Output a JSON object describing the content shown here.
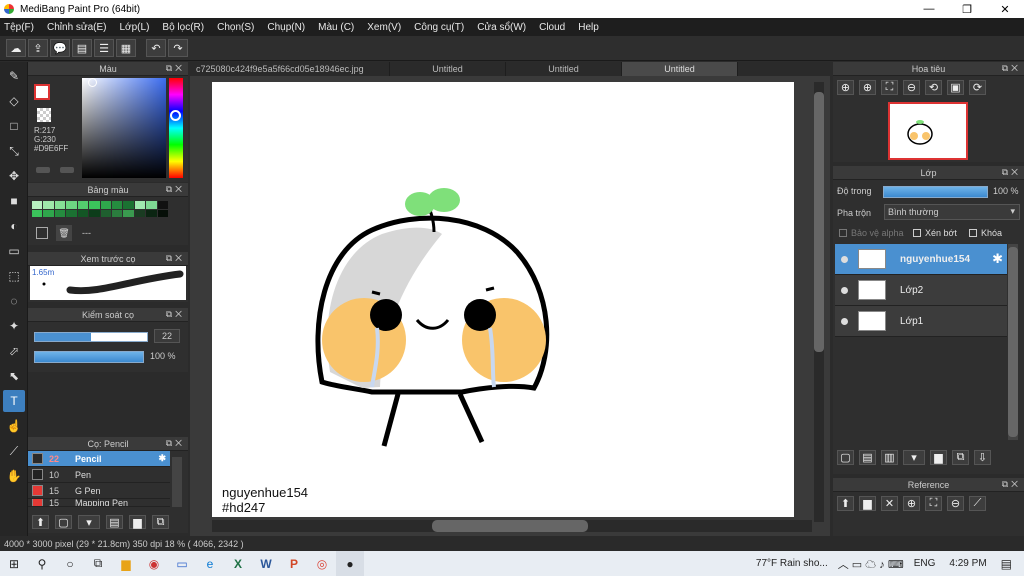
{
  "window": {
    "title": "MediBang Paint Pro (64bit)"
  },
  "menu": [
    "Tệp(F)",
    "Chỉnh sửa(E)",
    "Lớp(L)",
    "Bộ lọc(R)",
    "Chọn(S)",
    "Chụp(N)",
    "Màu (C)",
    "Xem(V)",
    "Công cụ(T)",
    "Cửa sổ(W)",
    "Cloud",
    "Help"
  ],
  "color_panel": {
    "title": "Màu",
    "r": "R:217",
    "g": "G:230",
    "hex": "#D9E6FF"
  },
  "palette_panel": {
    "title": "Bảng màu",
    "name": "---"
  },
  "preview_panel": {
    "title": "Xem trước cọ",
    "size": "1.65m"
  },
  "brush_control": {
    "title": "Kiểm soát cọ",
    "size": "22",
    "opacity": "100 %",
    "opacity_fraction": 1.0,
    "size_fraction": 0.5
  },
  "brush_panel": {
    "title": "Cọ: Pencil",
    "brushes": [
      {
        "size": "22",
        "name": "Pencil",
        "color": "#2a2a2a"
      },
      {
        "size": "10",
        "name": "Pen",
        "color": "#222222"
      },
      {
        "size": "15",
        "name": "G Pen",
        "color": "#e53935"
      },
      {
        "size": "15",
        "name": "Mapping Pen",
        "color": "#e53935"
      }
    ]
  },
  "tabs": [
    "c725080c424f9e5a5f66cd05e18946ec.jpg",
    "Untitled",
    "Untitled",
    "Untitled"
  ],
  "artwork": {
    "signature_line1": "nguyenhue154",
    "signature_line2": "#hd247"
  },
  "navigator": {
    "title": "Hoa tiêu"
  },
  "layer_panel": {
    "title": "Lớp",
    "opacity_label": "Độ trong",
    "opacity_value": "100 %",
    "opacity_fraction": 1.0,
    "blend_label": "Pha trộn",
    "blend_value": "Bình thường",
    "protect_alpha": "Bảo vệ alpha",
    "clip": "Xén bớt",
    "lock": "Khóa",
    "layers": [
      {
        "name": "nguyenhue154",
        "selected": true
      },
      {
        "name": "Lớp2",
        "selected": false
      },
      {
        "name": "Lớp1",
        "selected": false
      }
    ]
  },
  "reference_panel": {
    "title": "Reference"
  },
  "status": "4000 * 3000 pixel  (29 * 21.8cm)  350 dpi  18 %  ( 4066, 2342 )",
  "taskbar": {
    "weather": "77°F  Rain sho...",
    "lang": "ENG",
    "time": "4:29 PM"
  },
  "colors": {
    "accent": "#4a90d0",
    "sprout": "#7fe07a",
    "cheek": "#f9c46b"
  }
}
